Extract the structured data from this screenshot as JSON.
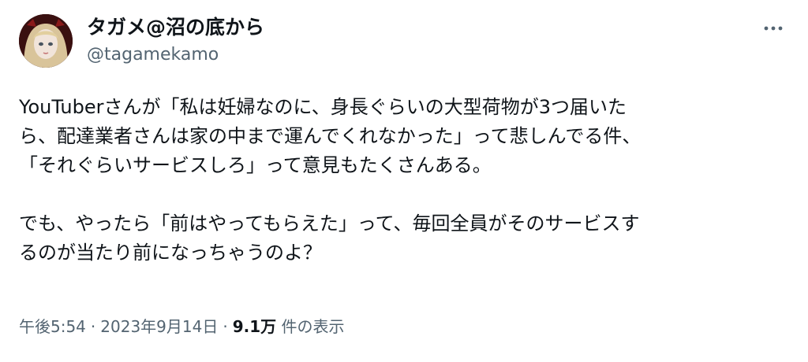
{
  "author": {
    "display_name": "タガメ@沼の底から",
    "handle": "@tagamekamo"
  },
  "icons": {
    "avatar": "profile-photo-doll",
    "more": "more-dots-icon"
  },
  "tweet": {
    "lines": [
      "YouTuberさんが「私は妊婦なのに、身長ぐらいの大型荷物が3つ届いた",
      "ら、配達業者さんは家の中まで運んでくれなかった」って悲しんでる件、",
      "「それぐらいサービスしろ」って意見もたくさんある。",
      "でも、やったら「前はやってもらえた」って、毎回全員がそのサービスす",
      "るのが当たり前になっちゃうのよ？"
    ]
  },
  "meta": {
    "time": "午後5:54",
    "separator": "·",
    "date": "2023年9月14日",
    "views_count": "9.1万",
    "views_label": "件の表示"
  }
}
